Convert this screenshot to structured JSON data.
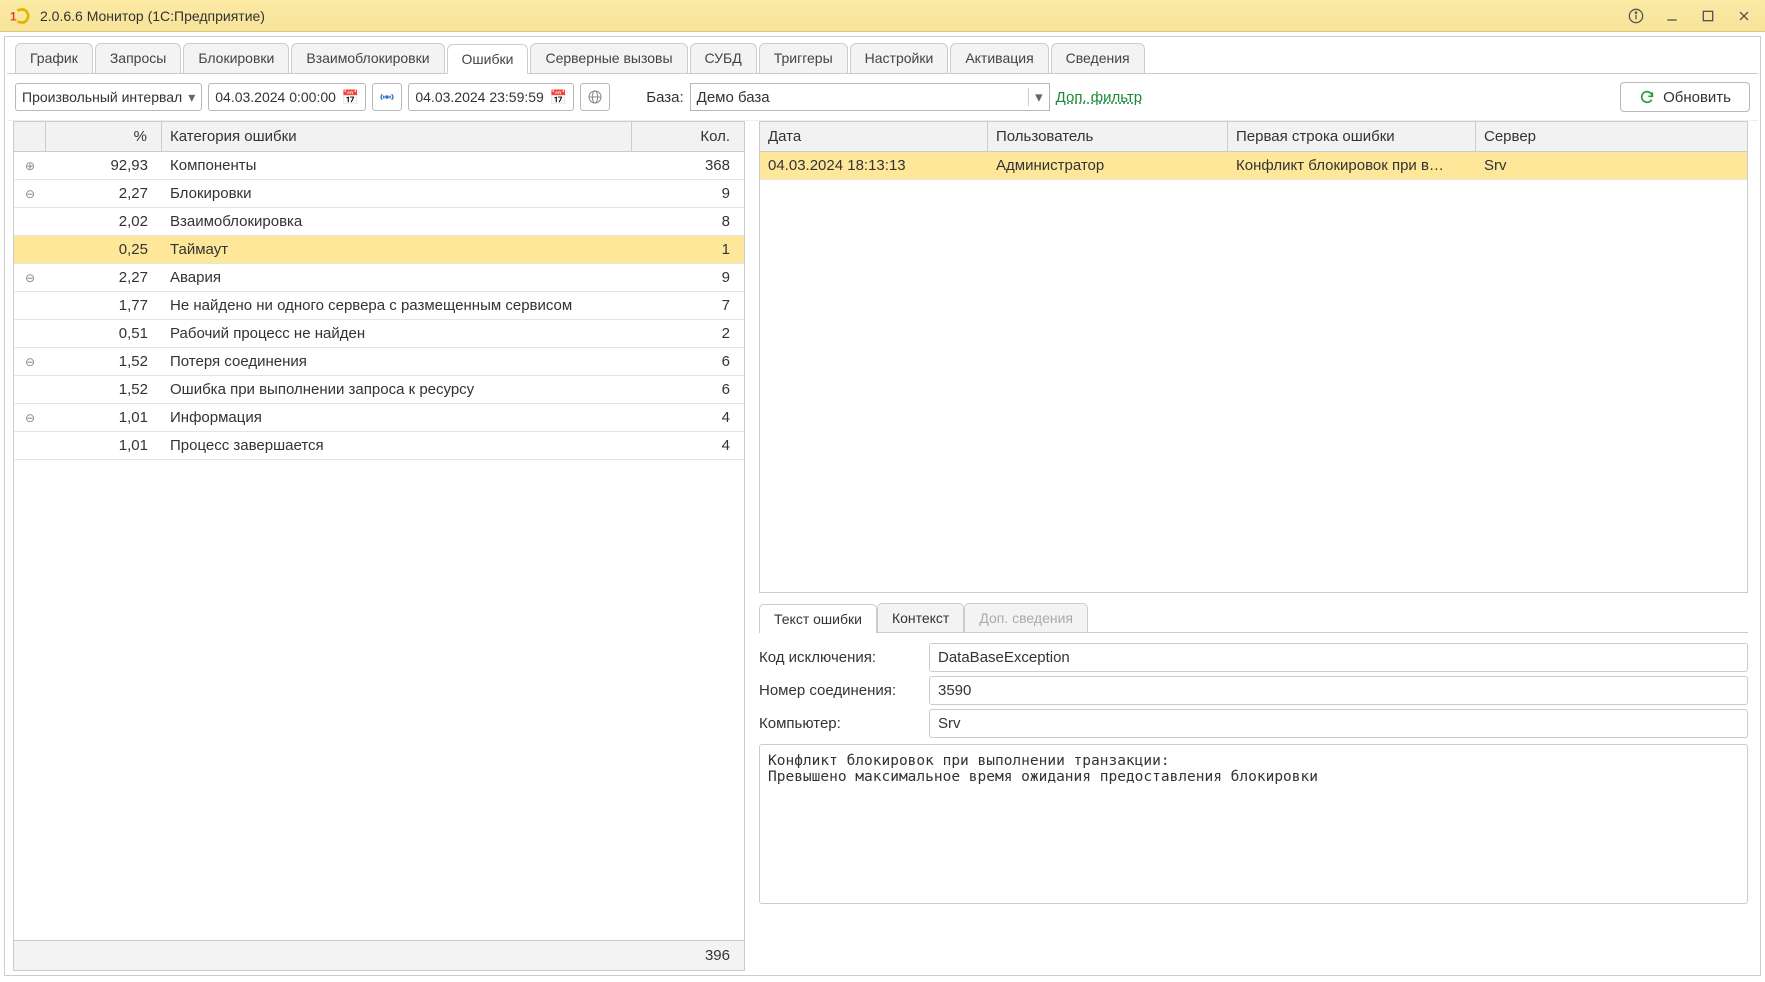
{
  "window": {
    "title": "2.0.6.6  Монитор  (1С:Предприятие)"
  },
  "tabs": [
    {
      "label": "График"
    },
    {
      "label": "Запросы"
    },
    {
      "label": "Блокировки"
    },
    {
      "label": "Взаимоблокировки"
    },
    {
      "label": "Ошибки",
      "active": true
    },
    {
      "label": "Серверные вызовы"
    },
    {
      "label": "СУБД"
    },
    {
      "label": "Триггеры"
    },
    {
      "label": "Настройки"
    },
    {
      "label": "Активация"
    },
    {
      "label": "Сведения"
    }
  ],
  "toolbar": {
    "interval": "Произвольный интервал",
    "date_from": "04.03.2024  0:00:00",
    "date_to": "04.03.2024 23:59:59",
    "base_label": "База:",
    "base_value": "Демо база",
    "filter_link": "Доп. фильтр",
    "refresh": "Обновить"
  },
  "left_grid": {
    "headers": {
      "pct": "%",
      "cat": "Категория ошибки",
      "cnt": "Кол."
    },
    "rows": [
      {
        "exp": "+",
        "pct": "92,93",
        "cat": "Компоненты",
        "cnt": "368"
      },
      {
        "exp": "−",
        "pct": "2,27",
        "cat": "Блокировки",
        "cnt": "9"
      },
      {
        "exp": "",
        "pct": "2,02",
        "cat": "Взаимоблокировка",
        "cnt": "8"
      },
      {
        "exp": "",
        "pct": "0,25",
        "cat": "Таймаут",
        "cnt": "1",
        "selected": true
      },
      {
        "exp": "−",
        "pct": "2,27",
        "cat": "Авария",
        "cnt": "9"
      },
      {
        "exp": "",
        "pct": "1,77",
        "cat": "Не найдено ни одного сервера с размещенным сервисом",
        "cnt": "7"
      },
      {
        "exp": "",
        "pct": "0,51",
        "cat": "Рабочий процесс не найден",
        "cnt": "2"
      },
      {
        "exp": "−",
        "pct": "1,52",
        "cat": "Потеря соединения",
        "cnt": "6"
      },
      {
        "exp": "",
        "pct": "1,52",
        "cat": "Ошибка при выполнении запроса к ресурсу",
        "cnt": "6"
      },
      {
        "exp": "−",
        "pct": "1,01",
        "cat": "Информация",
        "cnt": "4"
      },
      {
        "exp": "",
        "pct": "1,01",
        "cat": "Процесс завершается",
        "cnt": "4"
      }
    ],
    "total": "396"
  },
  "right_grid": {
    "headers": {
      "date": "Дата",
      "user": "Пользователь",
      "first": "Первая строка ошибки",
      "server": "Сервер"
    },
    "rows": [
      {
        "date": "04.03.2024 18:13:13",
        "user": "Администратор",
        "first": "Конфликт блокировок при в…",
        "server": "Srv",
        "selected": true
      }
    ]
  },
  "detail_tabs": [
    {
      "label": "Текст ошибки",
      "active": true
    },
    {
      "label": "Контекст"
    },
    {
      "label": "Доп. сведения",
      "disabled": true
    }
  ],
  "details": {
    "exc_label": "Код исключения:",
    "exc_val": "DataBaseException",
    "conn_label": "Номер соединения:",
    "conn_val": "3590",
    "comp_label": "Компьютер:",
    "comp_val": "Srv",
    "text": "Конфликт блокировок при выполнении транзакции:\nПревышено максимальное время ожидания предоставления блокировки"
  }
}
